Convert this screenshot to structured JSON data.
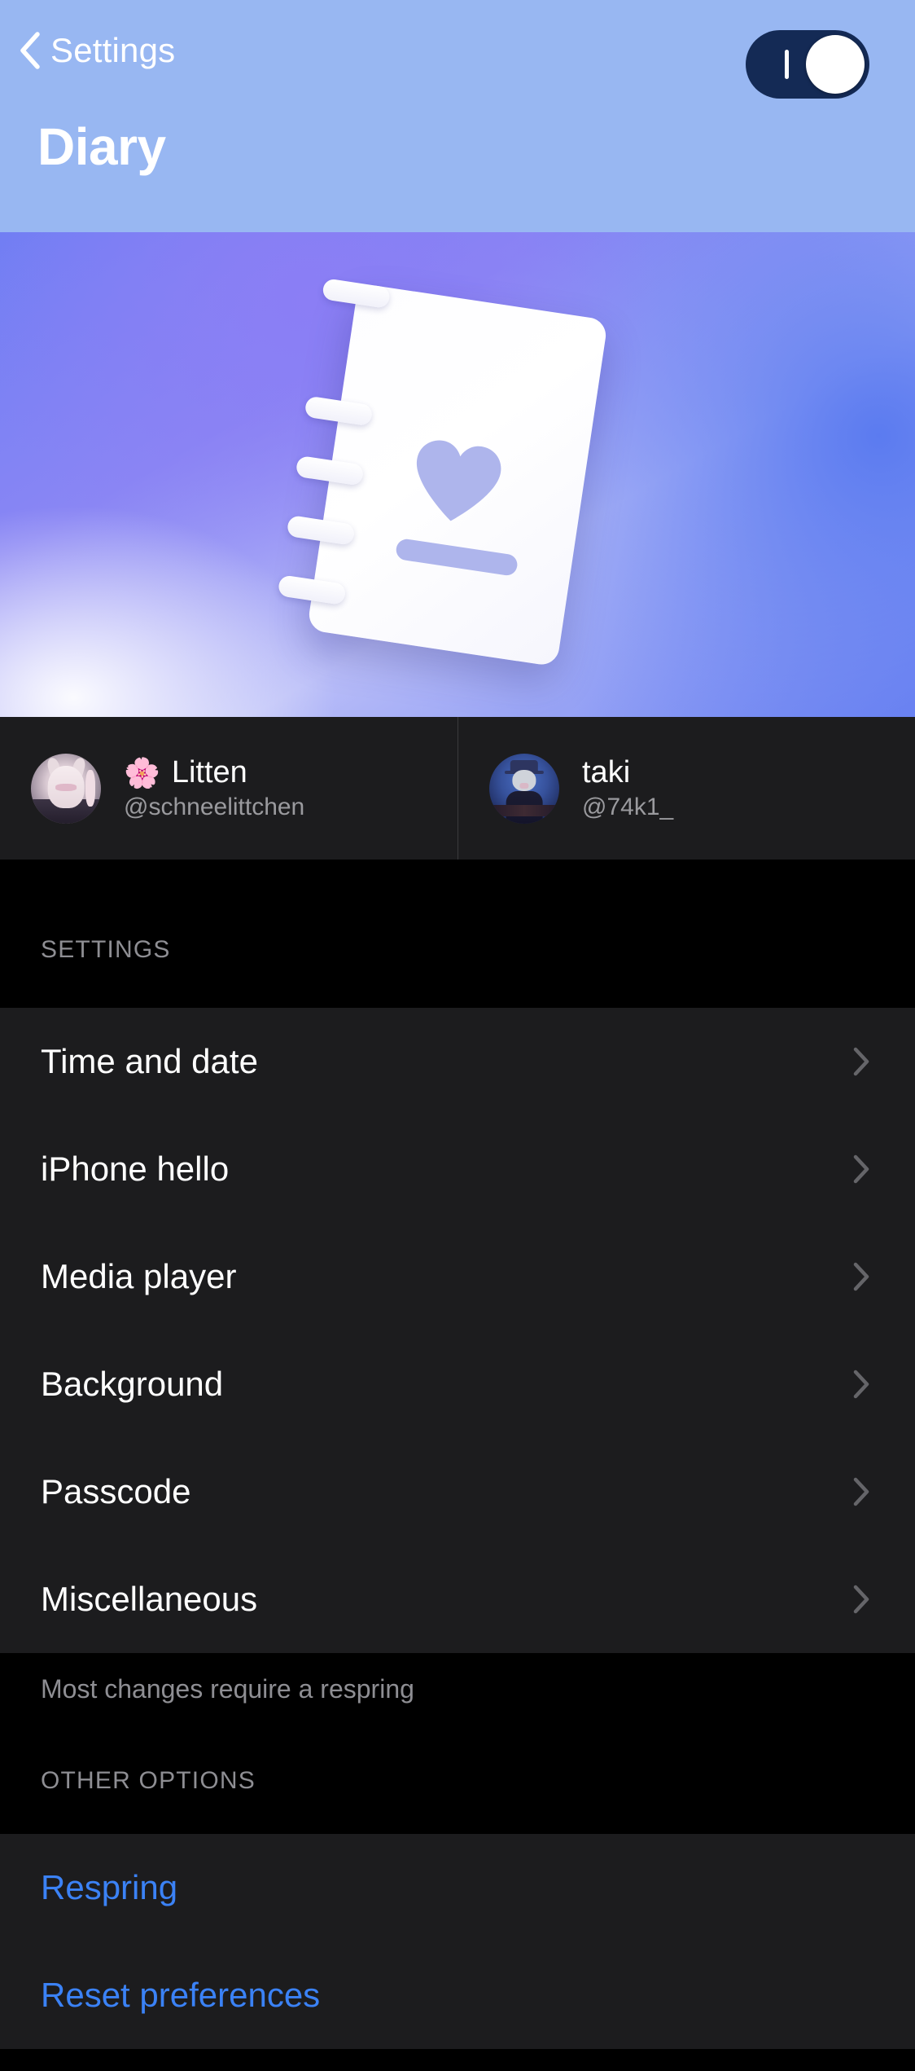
{
  "nav": {
    "back_label": "Settings",
    "back_icon": "chevron-left-icon",
    "title": "Diary",
    "toggle": {
      "name": "enable-tweak-toggle",
      "state": "on",
      "track_color": "#142a55",
      "knob_color": "#ffffff"
    }
  },
  "banner": {
    "icon": "diary-notebook-icon",
    "gradient_from": "#6f7ef3",
    "gradient_mid": "#b9bdf8",
    "gradient_to": "#6f84f2",
    "heart_color": "#aeb5ec"
  },
  "credits": [
    {
      "avatar": "litten-avatar",
      "emoji": "🌸",
      "name": "Litten",
      "handle": "@schneelittchen"
    },
    {
      "avatar": "taki-avatar",
      "emoji": "",
      "name": "taki",
      "handle": "@74k1_"
    }
  ],
  "sections": [
    {
      "header": "SETTINGS",
      "rows": [
        {
          "label": "Time and date",
          "accessory": "chevron-right-icon"
        },
        {
          "label": "iPhone hello",
          "accessory": "chevron-right-icon"
        },
        {
          "label": "Media player",
          "accessory": "chevron-right-icon"
        },
        {
          "label": "Background",
          "accessory": "chevron-right-icon"
        },
        {
          "label": "Passcode",
          "accessory": "chevron-right-icon"
        },
        {
          "label": "Miscellaneous",
          "accessory": "chevron-right-icon"
        }
      ],
      "footer": "Most changes require a respring"
    },
    {
      "header": "OTHER OPTIONS",
      "rows": [
        {
          "label": "Respring",
          "accessory": "none"
        },
        {
          "label": "Reset preferences",
          "accessory": "none"
        }
      ],
      "footer": ""
    }
  ],
  "colors": {
    "header_bg": "#98b7f2",
    "page_bg": "#000000",
    "cell_bg": "#1c1c1e",
    "secondary_text": "#8e8e93",
    "link_blue": "#3b82f6",
    "separator": "#3a3a3c"
  }
}
